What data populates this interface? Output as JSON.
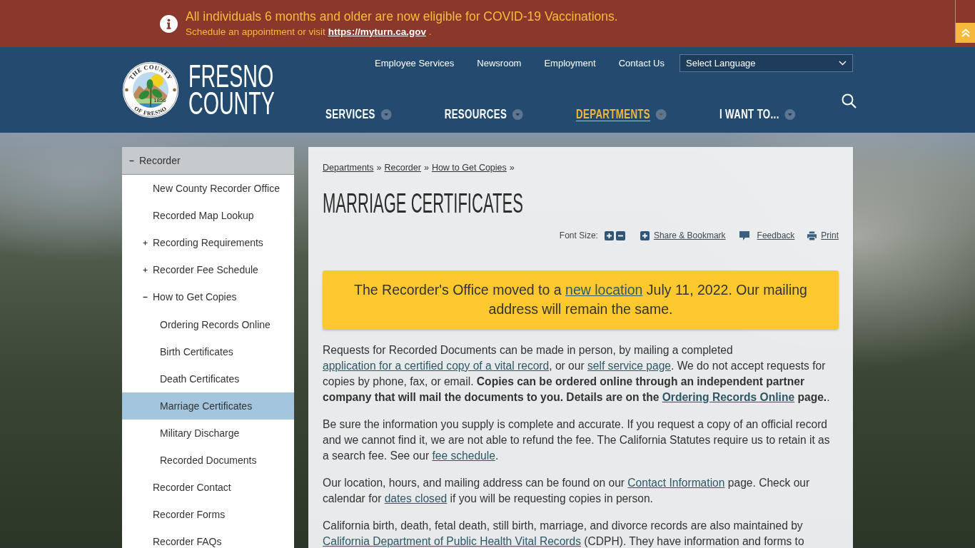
{
  "alert_banner": {
    "headline": "All individuals 6 months and older are now eligible for COVID-19 Vaccinations.",
    "message": "Schedule an appointment or visit",
    "link": "https://myturn.ca.gov",
    "trailing": "."
  },
  "header": {
    "seal": {
      "top_text": "THE COUNTY",
      "bottom_text": "OF FRESNO",
      "year": "1856"
    },
    "logo_lines": [
      "FRESNO",
      "COUNTY"
    ],
    "utility_links": [
      "Employee Services",
      "Newsroom",
      "Employment",
      "Contact Us"
    ],
    "language_select": {
      "value": "Select Language"
    },
    "nav": [
      {
        "label": "SERVICES",
        "selected": false
      },
      {
        "label": "RESOURCES",
        "selected": false
      },
      {
        "label": "DEPARTMENTS",
        "selected": true
      },
      {
        "label": "I WANT TO...",
        "selected": false
      }
    ]
  },
  "sidebar": {
    "kind": "section",
    "label": "Recorder",
    "expanded": true,
    "selected": false,
    "children": [
      {
        "kind": "page",
        "label": "New County Recorder Office",
        "selected": false
      },
      {
        "kind": "page",
        "label": "Recorded Map Lookup",
        "selected": false
      },
      {
        "kind": "section",
        "label": "Recording Requirements",
        "expanded": false,
        "selected": false
      },
      {
        "kind": "section",
        "label": "Recorder Fee Schedule",
        "expanded": false,
        "selected": false
      },
      {
        "kind": "section",
        "label": "How to Get Copies",
        "expanded": true,
        "selected": false,
        "children": [
          {
            "kind": "page",
            "label": "Ordering Records Online",
            "selected": false
          },
          {
            "kind": "page",
            "label": "Birth Certificates",
            "selected": false
          },
          {
            "kind": "page",
            "label": "Death Certificates",
            "selected": false
          },
          {
            "kind": "page",
            "label": "Marriage Certificates",
            "selected": true
          },
          {
            "kind": "page",
            "label": "Military Discharge",
            "selected": false
          },
          {
            "kind": "page",
            "label": "Recorded Documents",
            "selected": false
          }
        ]
      },
      {
        "kind": "page",
        "label": "Recorder Contact",
        "selected": false
      },
      {
        "kind": "page",
        "label": "Recorder Forms",
        "selected": false
      },
      {
        "kind": "page",
        "label": "Recorder FAQs",
        "selected": false
      }
    ]
  },
  "content": {
    "breadcrumb": [
      {
        "label": "Departments",
        "separator": "»"
      },
      {
        "label": "Recorder",
        "separator": "»"
      },
      {
        "label": "How to Get Copies",
        "separator": "»"
      }
    ],
    "title": "MARRIAGE CERTIFICATES",
    "tools": {
      "font_size_label": "Font Size:",
      "actions": [
        {
          "kind": "share",
          "label": "Share & Bookmark"
        },
        {
          "kind": "feedback",
          "label": "Feedback"
        },
        {
          "kind": "print",
          "label": "Print"
        }
      ]
    },
    "notice": {
      "segments": [
        {
          "kind": "text",
          "text": "The Recorder's Office moved to a "
        },
        {
          "kind": "link",
          "text": "new location"
        },
        {
          "kind": "text",
          "text": " July 11, 2022. Our mailing address will remain the same."
        }
      ]
    },
    "paragraphs": [
      {
        "segments": [
          {
            "kind": "text",
            "text": "Requests for Recorded Documents can be made in person, by mailing a completed "
          },
          {
            "kind": "link",
            "text": "application for a certified copy of a vital record"
          },
          {
            "kind": "text",
            "text": ", or our "
          },
          {
            "kind": "link",
            "text": "self service page"
          },
          {
            "kind": "text",
            "text": ". We do not accept requests for copies by phone, fax, or email. "
          },
          {
            "kind": "bold",
            "text": "Copies can be ordered online through an independent partner company that will mail the documents to you. Details are on the "
          },
          {
            "kind": "bold_link",
            "text": "Ordering Records Online"
          },
          {
            "kind": "bold",
            "text": " page."
          },
          {
            "kind": "text",
            "text": "."
          }
        ]
      },
      {
        "segments": [
          {
            "kind": "text",
            "text": "Be sure the information you supply is complete and accurate. If you request a copy of an official record and we cannot find it, we are not able to refund the fee. The California Statutes require us to retain it as a search fee. See our "
          },
          {
            "kind": "link",
            "text": "fee schedule"
          },
          {
            "kind": "text",
            "text": "."
          }
        ]
      },
      {
        "segments": [
          {
            "kind": "text",
            "text": "Our location, hours, and mailing address can be found on our "
          },
          {
            "kind": "link",
            "text": "Contact Information"
          },
          {
            "kind": "text",
            "text": " page. Check our calendar for "
          },
          {
            "kind": "link",
            "text": "dates closed"
          },
          {
            "kind": "text",
            "text": " if you will be requesting copies in person."
          }
        ]
      },
      {
        "segments": [
          {
            "kind": "text",
            "text": "California birth, death, fetal death, still birth, marriage, and divorce records are also maintained by "
          },
          {
            "kind": "link",
            "text": "California Department of Public Health Vital Records"
          },
          {
            "kind": "text",
            "text": " (CDPH). They have information and forms to"
          }
        ]
      }
    ]
  }
}
